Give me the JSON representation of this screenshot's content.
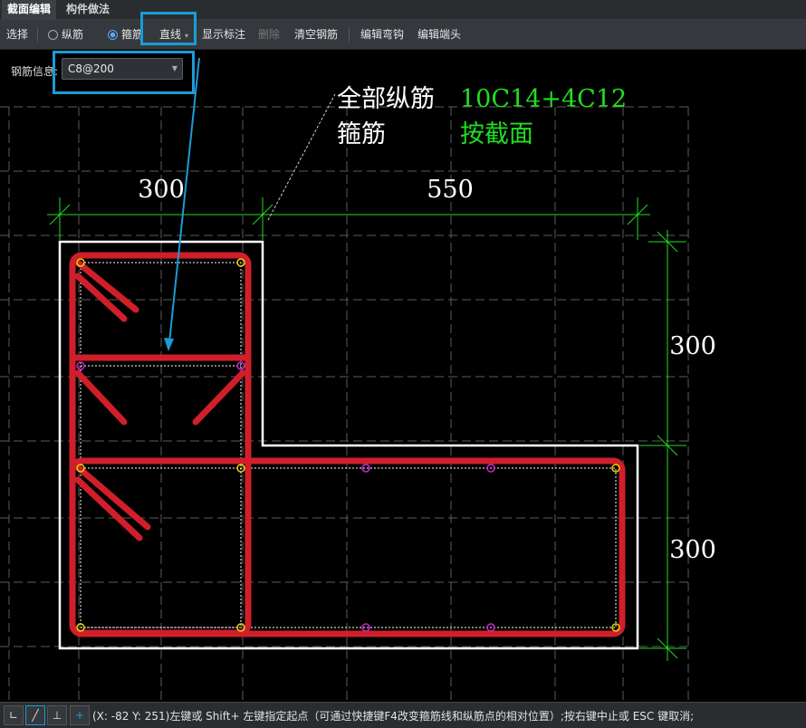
{
  "tabs": [
    {
      "label": "截面编辑",
      "active": true
    },
    {
      "label": "构件做法",
      "active": false
    }
  ],
  "toolbar": {
    "select": "选择",
    "longitudinal": "纵筋",
    "stirrup": "箍筋",
    "line_mode": "直线",
    "show_dim": "显示标注",
    "delete": "删除",
    "clear_rebar": "清空钢筋",
    "edit_hook": "编辑弯钩",
    "edit_end": "编辑端头"
  },
  "rebar_info": {
    "label": "钢筋信息:",
    "value": "C8@200"
  },
  "annotation": {
    "longitudinal_label": "全部纵筋",
    "longitudinal_value": "10C14+4C12",
    "stirrup_label": "箍筋",
    "stirrup_value": "按截面"
  },
  "dimensions": {
    "top_left": "300",
    "top_right": "550",
    "right_upper": "300",
    "right_lower": "300"
  },
  "colors": {
    "stirrup": "#d01f2a",
    "outline": "#ffffff",
    "dimension": "#22dd22",
    "corner_bar": "#e8d000",
    "side_bar": "#d020d0",
    "leader": "#1b9bd8",
    "value_text": "#22dd22"
  },
  "statusbar": {
    "tool_icons": [
      "orthogonal-icon",
      "line-icon",
      "perpendicular-icon",
      "add-icon"
    ],
    "message": "(X: -82 Y: 251)左键或 Shift+ 左键指定起点（可通过快捷键F4改变箍筋线和纵筋点的相对位置）;按右键中止或 ESC 键取消;"
  }
}
